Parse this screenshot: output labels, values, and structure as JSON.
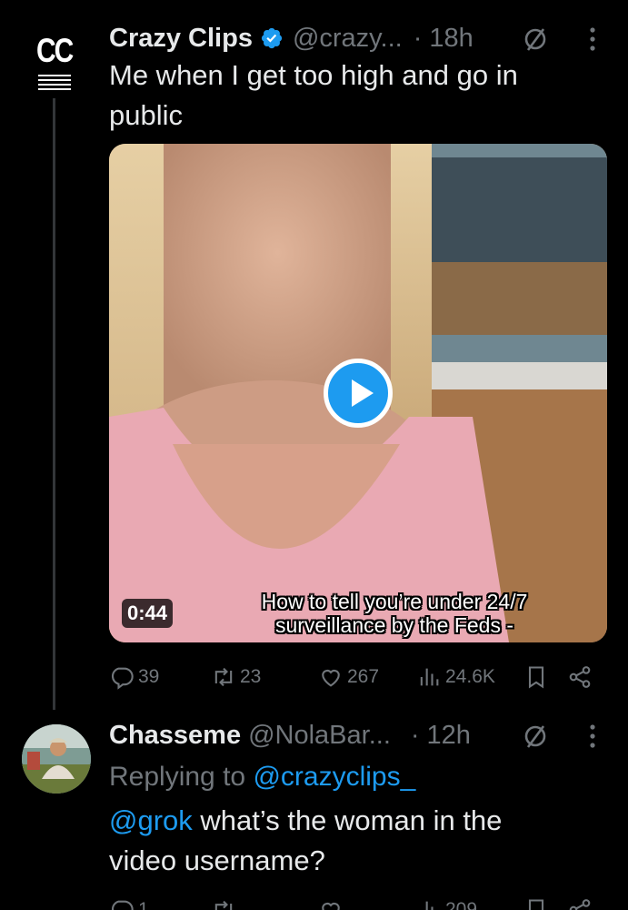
{
  "tweet": {
    "author_name": "Crazy Clips",
    "handle": "@crazy...",
    "dot": "·",
    "time": "18h",
    "text_lines": [
      "Me when I get too high and go in",
      "public"
    ],
    "video": {
      "duration": "0:44",
      "caption_lines": [
        "How to tell you’re under 24/7",
        "surveillance by the Feds -"
      ]
    },
    "actions": {
      "replies": "39",
      "retweets": "23",
      "likes": "267",
      "views": "24.6K"
    }
  },
  "reply": {
    "author_name": "Chasseme",
    "handle": "@NolaBar...",
    "dot": "·",
    "time": "12h",
    "replying_prefix": "Replying to",
    "replying_handle": "@crazyclips_",
    "mention": "@grok",
    "text_rest": "what’s the woman in the",
    "text_line2": "video username?",
    "actions": {
      "replies": "1",
      "views": "209"
    }
  },
  "colors": {
    "background": "#000000",
    "text": "#e7e9ea",
    "muted": "#71767b",
    "accent": "#1d9bf0",
    "thread_line": "#333639"
  },
  "icons": [
    "verified-badge-icon",
    "grok-icon",
    "more-icon",
    "reply-icon",
    "retweet-icon",
    "like-icon",
    "views-icon",
    "bookmark-icon",
    "share-icon",
    "play-icon"
  ]
}
